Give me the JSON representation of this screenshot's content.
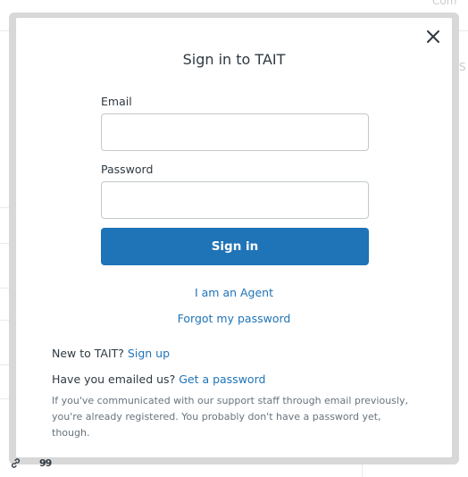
{
  "background": {
    "top_right_partial": "Com",
    "right_partial": "S"
  },
  "modal": {
    "title": "Sign in to TAIT",
    "email_label": "Email",
    "email_value": "",
    "password_label": "Password",
    "password_value": "",
    "sign_in_label": "Sign in",
    "agent_link": "I am an Agent",
    "forgot_link": "Forgot my password",
    "new_prefix": "New to TAIT?",
    "signup_link": "Sign up",
    "emailed_prefix": "Have you emailed us?",
    "get_password_link": "Get a password",
    "note": "If you've communicated with our support staff through email previously, you're already registered. You probably don't have a password yet, though."
  },
  "colors": {
    "accent": "#1f73b7",
    "text": "#2f3941",
    "muted": "#68737d",
    "frame": "#d8d8d8"
  },
  "icons": {
    "close": "close-icon",
    "link": "link-icon",
    "quote": "quote-icon"
  }
}
